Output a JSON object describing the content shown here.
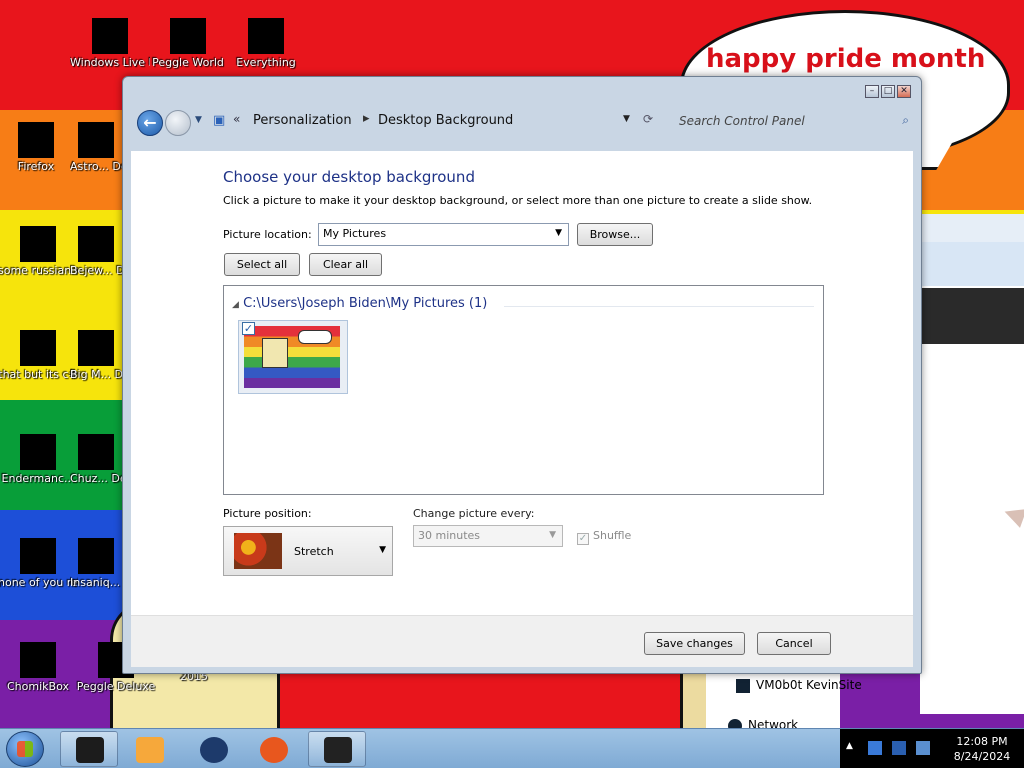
{
  "desktop": {
    "bubble_text": "happy pride month",
    "icons": [
      {
        "label": "Windows Live Ma..."
      },
      {
        "label": "Peggle World"
      },
      {
        "label": "Everything"
      },
      {
        "label": "Firefox"
      },
      {
        "label": "Astro... Delu..."
      },
      {
        "label": "some russian ran a rat"
      },
      {
        "label": "Bejew... Delu..."
      },
      {
        "label": "that but its c#"
      },
      {
        "label": "Big M... Delu..."
      },
      {
        "label": "Endermanc..."
      },
      {
        "label": "Chuz... Delu..."
      },
      {
        "label": "none of you retards kno..."
      },
      {
        "label": "Insaniq... Delu..."
      },
      {
        "label": "ChomikBox"
      },
      {
        "label": "Peggle Deluxe"
      },
      {
        "label": "Visual Studio 2015"
      }
    ],
    "side_items": [
      {
        "label": "VM0b0t KevinSite"
      },
      {
        "label": "Network"
      }
    ]
  },
  "window": {
    "title_buttons": {
      "minimize": "–",
      "maximize": "□",
      "close": "✕"
    },
    "breadcrumb": [
      "Personalization",
      "Desktop Background"
    ],
    "breadcrumb_overflow": "«",
    "breadcrumb_separator": "▸",
    "search_placeholder": "Search Control Panel",
    "page_title": "Choose your desktop background",
    "instructions": "Click a picture to make it your desktop background, or select more than one picture to create a slide show.",
    "picture_location_label": "Picture location:",
    "picture_location_value": "My Pictures",
    "browse_label": "Browse...",
    "select_all_label": "Select all",
    "clear_all_label": "Clear all",
    "group_header": "C:\\Users\\Joseph Biden\\My Pictures (1)",
    "picture_position_label": "Picture position:",
    "picture_position_value": "Stretch",
    "change_picture_label": "Change picture every:",
    "change_picture_value": "30 minutes",
    "shuffle_label": "Shuffle",
    "save_label": "Save changes",
    "cancel_label": "Cancel"
  },
  "taskbar": {
    "clock_time": "12:08 PM",
    "clock_date": "8/24/2024"
  }
}
